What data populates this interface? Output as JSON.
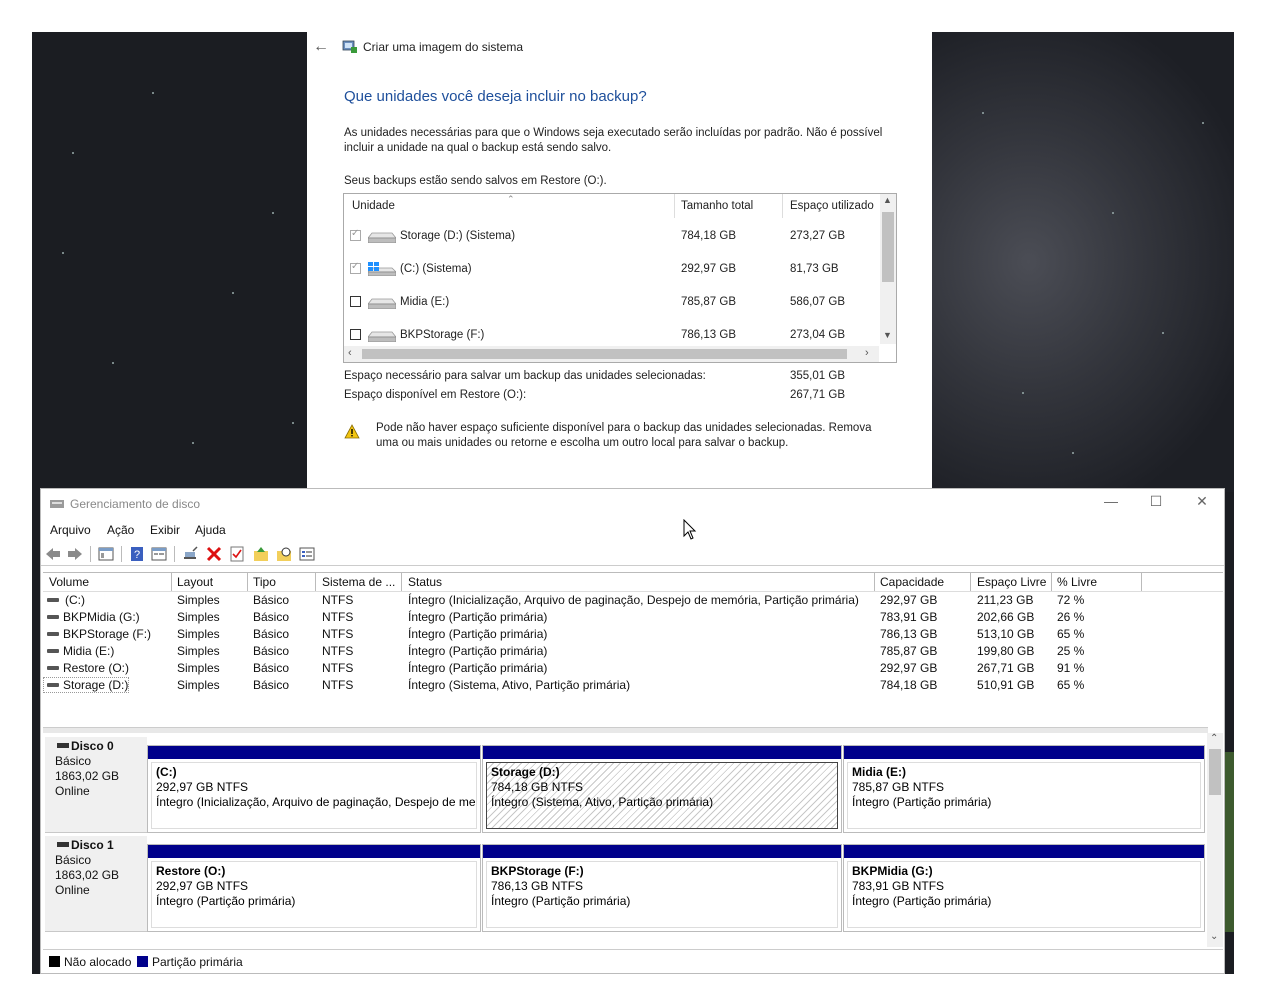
{
  "backup": {
    "title": "Criar uma imagem do sistema",
    "question": "Que unidades você deseja incluir no backup?",
    "intro": "As unidades necessárias para que o Windows seja executado serão incluídas por padrão. Não é possível incluir a unidade na qual o backup está sendo salvo.",
    "saving_to": "Seus backups estão sendo salvos em Restore (O:).",
    "columns": [
      "Unidade",
      "Tamanho total",
      "Espaço utilizado"
    ],
    "rows": [
      {
        "name": "Storage (D:) (Sistema)",
        "total": "784,18 GB",
        "used": "273,27 GB",
        "checked": true,
        "icon": "drive-icon"
      },
      {
        "name": "(C:) (Sistema)",
        "total": "292,97 GB",
        "used": "81,73 GB",
        "checked": true,
        "icon": "windows-drive-icon"
      },
      {
        "name": "Midia (E:)",
        "total": "785,87 GB",
        "used": "586,07 GB",
        "checked": false,
        "icon": "drive-icon"
      },
      {
        "name": "BKPStorage (F:)",
        "total": "786,13 GB",
        "used": "273,04 GB",
        "checked": false,
        "icon": "drive-icon"
      }
    ],
    "needed_label": "Espaço necessário para salvar um backup das unidades selecionadas:",
    "needed_value": "355,01 GB",
    "available_label": "Espaço disponível em Restore (O:):",
    "available_value": "267,71 GB",
    "warning": "Pode não haver espaço suficiente disponível para o backup das unidades selecionadas. Remova uma ou mais unidades ou retorne e escolha um outro local para salvar o backup."
  },
  "diskmgmt": {
    "title": "Gerenciamento de disco",
    "menu": [
      "Arquivo",
      "Ação",
      "Exibir",
      "Ajuda"
    ],
    "columns": [
      "Volume",
      "Layout",
      "Tipo",
      "Sistema de ...",
      "Status",
      "Capacidade",
      "Espaço Livre",
      "% Livre"
    ],
    "volumes": [
      {
        "volume": "(C:)",
        "layout": "Simples",
        "tipo": "Básico",
        "fs": "NTFS",
        "status": "Íntegro (Inicialização, Arquivo de paginação, Despejo de memória, Partição primária)",
        "cap": "292,97 GB",
        "free": "211,23 GB",
        "pct": "72 %"
      },
      {
        "volume": "BKPMidia (G:)",
        "layout": "Simples",
        "tipo": "Básico",
        "fs": "NTFS",
        "status": "Íntegro (Partição primária)",
        "cap": "783,91 GB",
        "free": "202,66 GB",
        "pct": "26 %"
      },
      {
        "volume": "BKPStorage (F:)",
        "layout": "Simples",
        "tipo": "Básico",
        "fs": "NTFS",
        "status": "Íntegro (Partição primária)",
        "cap": "786,13 GB",
        "free": "513,10 GB",
        "pct": "65 %"
      },
      {
        "volume": "Midia (E:)",
        "layout": "Simples",
        "tipo": "Básico",
        "fs": "NTFS",
        "status": "Íntegro (Partição primária)",
        "cap": "785,87 GB",
        "free": "199,80 GB",
        "pct": "25 %"
      },
      {
        "volume": "Restore (O:)",
        "layout": "Simples",
        "tipo": "Básico",
        "fs": "NTFS",
        "status": "Íntegro (Partição primária)",
        "cap": "292,97 GB",
        "free": "267,71 GB",
        "pct": "91 %"
      },
      {
        "volume": "Storage (D:)",
        "layout": "Simples",
        "tipo": "Básico",
        "fs": "NTFS",
        "status": "Íntegro (Sistema, Ativo, Partição primária)",
        "cap": "784,18 GB",
        "free": "510,91 GB",
        "pct": "65 %"
      }
    ],
    "disks": [
      {
        "name": "Disco 0",
        "type": "Básico",
        "size": "1863,02 GB",
        "state": "Online",
        "parts": [
          {
            "title": "(C:)",
            "size": "292,97 GB NTFS",
            "status": "Íntegro (Inicialização, Arquivo de paginação, Despejo de mer"
          },
          {
            "title": "Storage  (D:)",
            "size": "784,18 GB NTFS",
            "status": "Íntegro (Sistema, Ativo, Partição primária)"
          },
          {
            "title": "Midia  (E:)",
            "size": "785,87 GB NTFS",
            "status": "Íntegro (Partição primária)"
          }
        ]
      },
      {
        "name": "Disco 1",
        "type": "Básico",
        "size": "1863,02 GB",
        "state": "Online",
        "parts": [
          {
            "title": "Restore  (O:)",
            "size": "292,97 GB NTFS",
            "status": "Íntegro (Partição primária)"
          },
          {
            "title": "BKPStorage  (F:)",
            "size": "786,13 GB NTFS",
            "status": "Íntegro (Partição primária)"
          },
          {
            "title": "BKPMidia  (G:)",
            "size": "783,91 GB NTFS",
            "status": "Íntegro (Partição primária)"
          }
        ]
      }
    ],
    "legend": {
      "unallocated": "Não alocado",
      "primary": "Partição primária",
      "unallocated_color": "#000000",
      "primary_color": "#00008b"
    }
  }
}
